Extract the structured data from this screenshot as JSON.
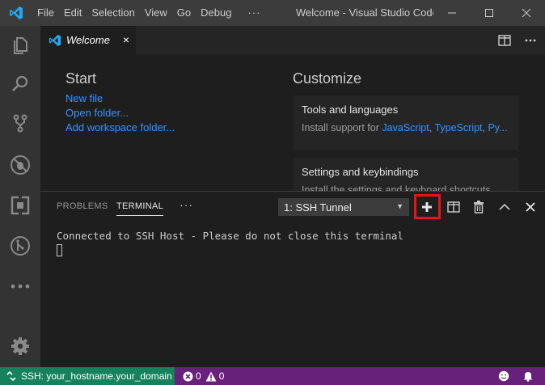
{
  "menu": [
    "File",
    "Edit",
    "Selection",
    "View",
    "Go",
    "Debug"
  ],
  "menu_more": "···",
  "window_title": "Welcome - Visual Studio Code",
  "tab": {
    "label": "Welcome",
    "close": "×"
  },
  "welcome": {
    "start_title": "Start",
    "start_links": [
      "New file",
      "Open folder...",
      "Add workspace folder..."
    ],
    "customize_title": "Customize",
    "cards": [
      {
        "title": "Tools and languages",
        "desc_prefix": "Install support for ",
        "links": [
          "JavaScript",
          "TypeScript",
          "Py..."
        ]
      },
      {
        "title": "Settings and keybindings",
        "desc": "Install the settings and keyboard shortcuts"
      }
    ]
  },
  "panel": {
    "tabs": [
      "PROBLEMS",
      "TERMINAL"
    ],
    "active_tab": "TERMINAL",
    "more": "···",
    "terminal_select": "1: SSH Tunnel",
    "terminal_output": "Connected to SSH Host - Please do not close this terminal"
  },
  "status": {
    "remote": "SSH: your_hostname.your_domain",
    "errors": "0",
    "warnings": "0"
  },
  "colors": {
    "accent_blue": "#3794ff",
    "remote_green": "#16825d",
    "statusbar_purple": "#68217a",
    "highlight_red": "#e8141b",
    "vscode_logo": "#23a9f2"
  }
}
